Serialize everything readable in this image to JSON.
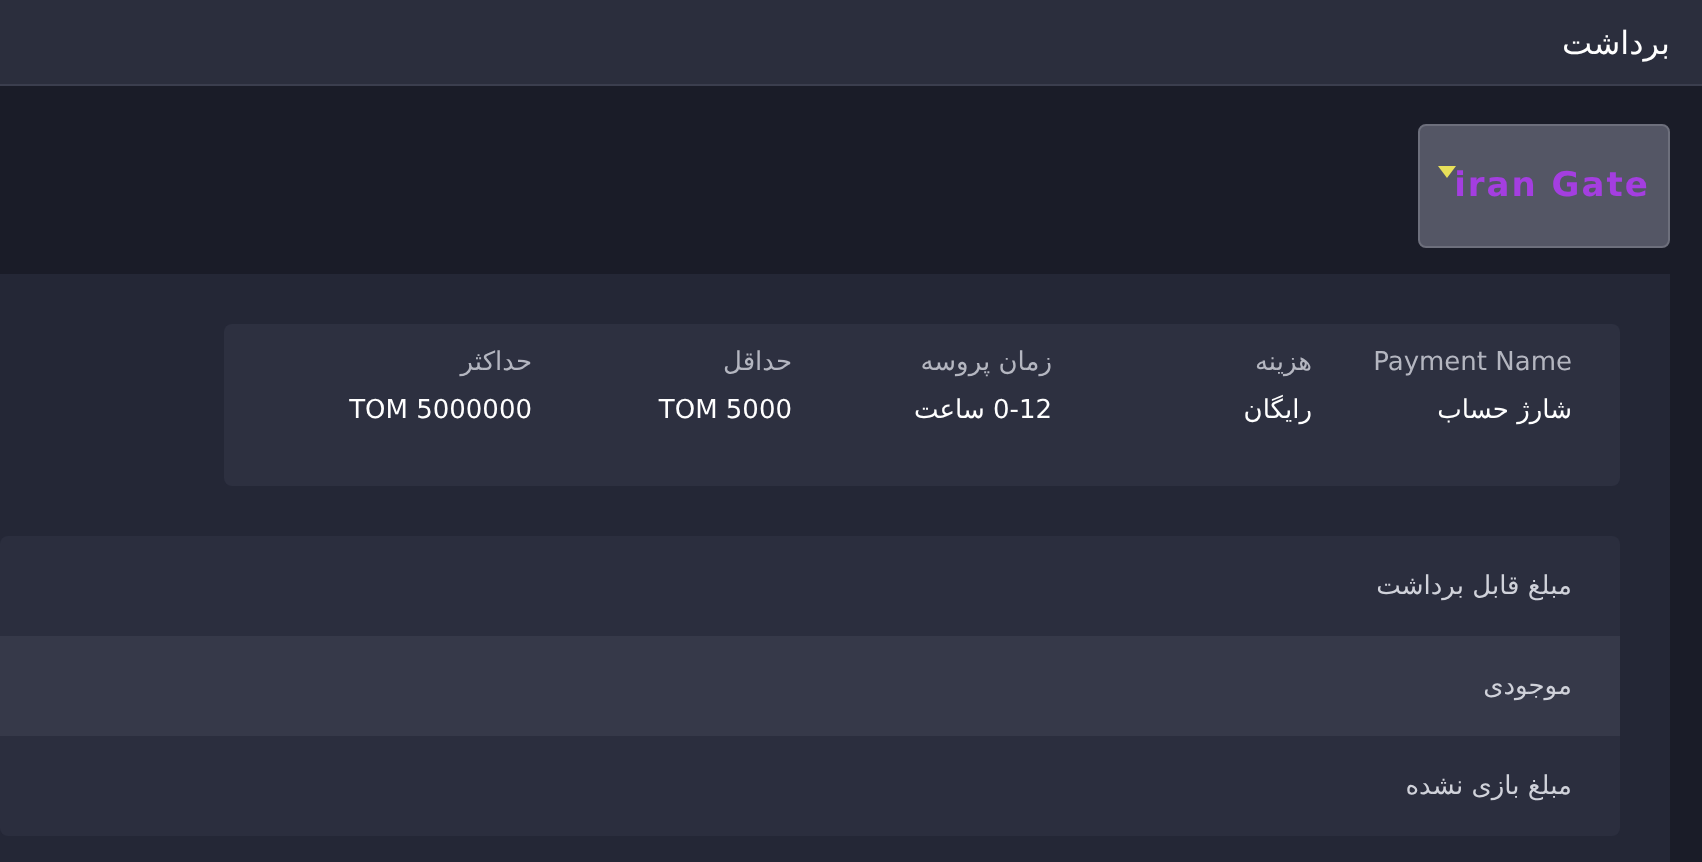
{
  "header": {
    "title": "برداشت"
  },
  "logo": {
    "text": "iran Gate"
  },
  "payment_info": {
    "columns": [
      {
        "label": "Payment Name",
        "value": "شارژ حساب"
      },
      {
        "label": "هزینه",
        "value": "رایگان"
      },
      {
        "label": "زمان پروسه",
        "value": "0-12 ساعت"
      },
      {
        "label": "حداقل",
        "value": "TOM 5000"
      },
      {
        "label": "حداکثر",
        "value": "TOM 5000000"
      }
    ]
  },
  "balance_rows": [
    {
      "label": "مبلغ قابل برداشت"
    },
    {
      "label": "موجودی"
    },
    {
      "label": "مبلغ بازی نشده"
    }
  ]
}
